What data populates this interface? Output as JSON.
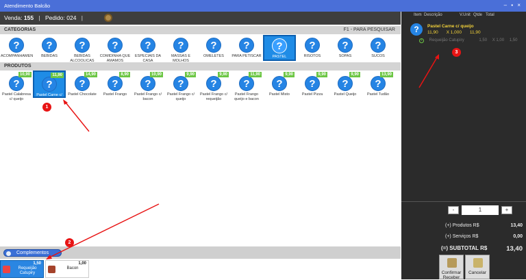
{
  "window": {
    "title": "Atendimento Balcão",
    "controls": "– ▪ ×"
  },
  "info": {
    "venda_label": "Venda:",
    "venda_value": "155",
    "pedido_label": "Pedido:",
    "pedido_value": "024"
  },
  "categorias": {
    "title": "CATEGORIAS",
    "hint": "F1  - PARA PESQUISAR",
    "items": [
      {
        "label": "ACOMPANHAMENTOS"
      },
      {
        "label": "BEBIDAS"
      },
      {
        "label": "BEBIDAS ALCOOLICAS"
      },
      {
        "label": "COMIDINHA QUE AMAMOS"
      },
      {
        "label": "ESPECIAIS DA CASA"
      },
      {
        "label": "MASSAS E MOLHOS"
      },
      {
        "label": "OMELETES"
      },
      {
        "label": "PARA PETISCAR"
      },
      {
        "label": "PASTEL",
        "selected": true
      },
      {
        "label": "RISOTOS"
      },
      {
        "label": "SOPAS"
      },
      {
        "label": "SUCOS"
      }
    ]
  },
  "produtos": {
    "title": "PRODUTOS",
    "items": [
      {
        "label": "Pastel Calabresa c/ queijo",
        "price": "10,90"
      },
      {
        "label": "Pastel Carne c/ queijo",
        "price": "11,90",
        "selected": true
      },
      {
        "label": "Pastel Chocolate",
        "price": "14,90"
      },
      {
        "label": "Pastel Frango",
        "price": "8,90"
      },
      {
        "label": "Pastel Frango c/ bacon",
        "price": "10,90"
      },
      {
        "label": "Pastel Frango c/ queijo",
        "price": "9,90"
      },
      {
        "label": "Pastel Frango c/ requeijão",
        "price": "9,90"
      },
      {
        "label": "Pastel Frango queijo e bacon",
        "price": "11,90"
      },
      {
        "label": "Pastel Misto",
        "price": "9,90"
      },
      {
        "label": "Pastel Pizza",
        "price": "9,90"
      },
      {
        "label": "Pastel Queijo",
        "price": "9,90"
      },
      {
        "label": "Pastel Tudão",
        "price": "13,90"
      }
    ]
  },
  "complementos": {
    "button_label": "Complementos",
    "items": [
      {
        "label": "Requeijão Catupiry",
        "price": "1,50",
        "selected": true
      },
      {
        "label": "Bacon",
        "price": "1,00"
      }
    ]
  },
  "order": {
    "headers": {
      "item": "Item",
      "descricao": "Descrição",
      "vunit": "V.Unit",
      "qtde": "Qtde",
      "total": "Total"
    },
    "line": {
      "name": "Pastel Carne c/ queijo",
      "vunit": "11,90",
      "qtde": "X 1,000",
      "total": "11,90"
    },
    "complement": {
      "name": "Requeijão Catupiry",
      "vunit": "1,50",
      "qtde": "X 1,00",
      "total": "1,50"
    }
  },
  "qty": {
    "minus": "-",
    "value": "1",
    "plus": "+"
  },
  "totals": {
    "produtos_label": "(+) Produtos R$",
    "produtos_value": "13,40",
    "servicos_label": "(+) Serviços R$",
    "servicos_value": "0,00",
    "subtotal_label": "(=) SUBTOTAL R$",
    "subtotal_value": "13,40"
  },
  "actions": {
    "confirm_label": "Confirmar Receber",
    "cancel_label": "Cancelar"
  },
  "annotations": {
    "one": "1",
    "two": "2",
    "three": "3"
  },
  "colors": {
    "title_bar": "#4a6fd8",
    "accent_blue": "#2584e4",
    "price_green": "#6cc644",
    "order_yellow": "#f4d33a",
    "annotation_red": "#e81414"
  }
}
